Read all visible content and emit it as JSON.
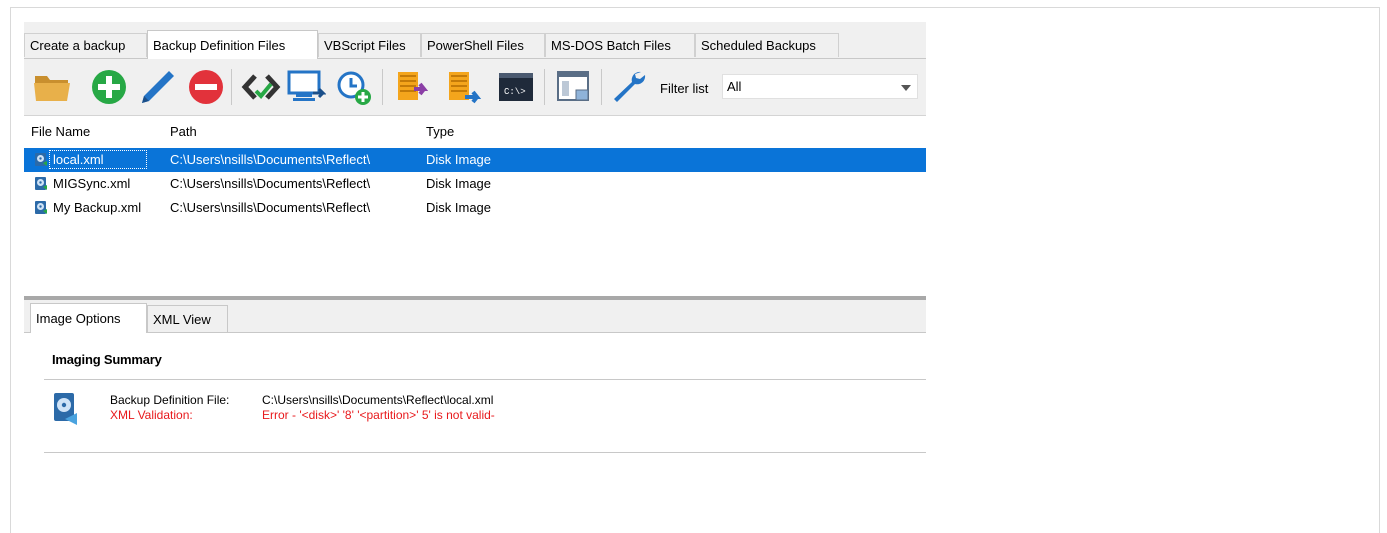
{
  "tabs": [
    {
      "label": "Create a backup"
    },
    {
      "label": "Backup Definition Files"
    },
    {
      "label": "VBScript Files"
    },
    {
      "label": "PowerShell Files"
    },
    {
      "label": "MS-DOS Batch Files"
    },
    {
      "label": "Scheduled Backups"
    }
  ],
  "active_tab": "Backup Definition Files",
  "toolbar": {
    "icons": [
      "open-folder-icon",
      "add-icon",
      "edit-icon",
      "delete-icon",
      "xml-code-icon",
      "validate-icon",
      "schedule-add-icon",
      "script-generate-icon",
      "script-run-icon",
      "command-prompt-icon",
      "window-view-icon",
      "settings-wrench-icon"
    ],
    "filter_label": "Filter list",
    "filter_value": "All"
  },
  "list": {
    "columns": {
      "name": "File Name",
      "path": "Path",
      "type": "Type"
    },
    "rows": [
      {
        "name": "local.xml",
        "path": "C:\\Users\\nsills\\Documents\\Reflect\\",
        "type": "Disk Image",
        "selected": true
      },
      {
        "name": "MIGSync.xml",
        "path": "C:\\Users\\nsills\\Documents\\Reflect\\",
        "type": "Disk Image",
        "selected": false
      },
      {
        "name": "My Backup.xml",
        "path": "C:\\Users\\nsills\\Documents\\Reflect\\",
        "type": "Disk Image",
        "selected": false
      }
    ]
  },
  "bottom_tabs": [
    {
      "label": "Image Options"
    },
    {
      "label": "XML View"
    }
  ],
  "summary": {
    "title": "Imaging Summary",
    "definition_file_label": "Backup Definition File:",
    "definition_file_value": "C:\\Users\\nsills\\Documents\\Reflect\\local.xml",
    "validation_label": "XML Validation:",
    "validation_value": "Error - '<disk>' '8' '<partition>' 5' is not valid-"
  },
  "colors": {
    "selection": "#0a74d8",
    "error_text": "#e8191c",
    "add_green": "#27a845",
    "delete_red": "#e2323b",
    "edit_blue": "#2474c6",
    "script_orange": "#f4a51c"
  }
}
